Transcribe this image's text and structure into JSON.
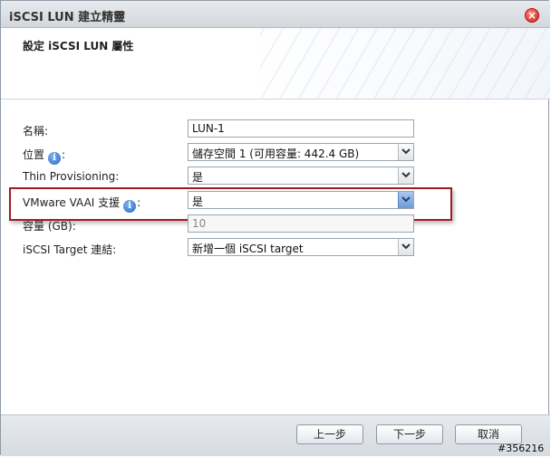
{
  "window": {
    "title": "iSCSI LUN 建立精靈",
    "close_icon": "close-icon"
  },
  "header": {
    "title": "設定 iSCSI LUN 屬性"
  },
  "form": {
    "name": {
      "label": "名稱:",
      "value": "LUN-1"
    },
    "location": {
      "label": "位置",
      "colon": ":",
      "value": "儲存空間 1 (可用容量: 442.4 GB)"
    },
    "thin_provisioning": {
      "label": "Thin Provisioning:",
      "value": "是"
    },
    "vaai": {
      "label": "VMware VAAI 支援",
      "colon": ":",
      "value": "是"
    },
    "capacity": {
      "label": "容量 (GB):",
      "value": "10"
    },
    "target": {
      "label": "iSCSI Target 連結:",
      "value": "新增一個 iSCSI target"
    },
    "info_glyph": "i"
  },
  "buttons": {
    "back": "上一步",
    "next": "下一步",
    "cancel": "取消"
  },
  "watermark": "#356216",
  "colors": {
    "highlight": "#a21b22",
    "info": "#2667c2",
    "close": "#c81e10"
  }
}
